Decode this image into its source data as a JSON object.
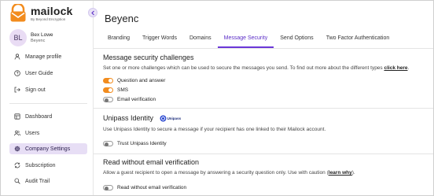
{
  "sidebar": {
    "logo": {
      "name": "mailock",
      "tagline": "By Beyond Encryption"
    },
    "user": {
      "initials": "BL",
      "name": "Bex Lowe",
      "org": "Beyenc"
    },
    "account_items": [
      {
        "label": "Manage profile",
        "icon": "person-icon"
      },
      {
        "label": "User Guide",
        "icon": "help-circle-icon"
      },
      {
        "label": "Sign out",
        "icon": "sign-out-icon"
      }
    ],
    "nav_items": [
      {
        "label": "Dashboard",
        "icon": "dashboard-icon",
        "active": false
      },
      {
        "label": "Users",
        "icon": "users-icon",
        "active": false
      },
      {
        "label": "Company Settings",
        "icon": "gear-icon",
        "active": true
      },
      {
        "label": "Subscription",
        "icon": "subscription-icon",
        "active": false
      },
      {
        "label": "Audit Trail",
        "icon": "audit-icon",
        "active": false
      }
    ]
  },
  "main": {
    "title": "Beyenc",
    "tabs": [
      {
        "label": "Branding",
        "active": false
      },
      {
        "label": "Trigger Words",
        "active": false
      },
      {
        "label": "Domains",
        "active": false
      },
      {
        "label": "Message Security",
        "active": true
      },
      {
        "label": "Send Options",
        "active": false
      },
      {
        "label": "Two Factor Authentication",
        "active": false
      }
    ],
    "challenges": {
      "title": "Message security challenges",
      "desc": "Set one or more challenges which can be used to secure the messages you send. To find out more about the different types ",
      "link": "click here",
      "link_suffix": ".",
      "toggles": [
        {
          "label": "Question and answer",
          "on": true
        },
        {
          "label": "SMS",
          "on": true
        },
        {
          "label": "Email verification",
          "on": false
        }
      ]
    },
    "unipass": {
      "title": "Unipass Identity",
      "badge": "Unipass",
      "desc": "Use Unipass Identity to secure a message if your recipient has one linked to their Mailock account.",
      "toggle": {
        "label": "Trust Unipass Identity",
        "on": false
      }
    },
    "read_without": {
      "title": "Read without email verification",
      "desc": "Allow a guest recipient to open a message by answering a security question only. Use with caution (",
      "link": "learn why",
      "link_suffix": ").",
      "toggle": {
        "label": "Read without email verification",
        "on": false
      }
    }
  },
  "colors": {
    "accent": "#6b38d8",
    "toggle_on": "#f28c1e",
    "active_nav": "#e7def5"
  }
}
